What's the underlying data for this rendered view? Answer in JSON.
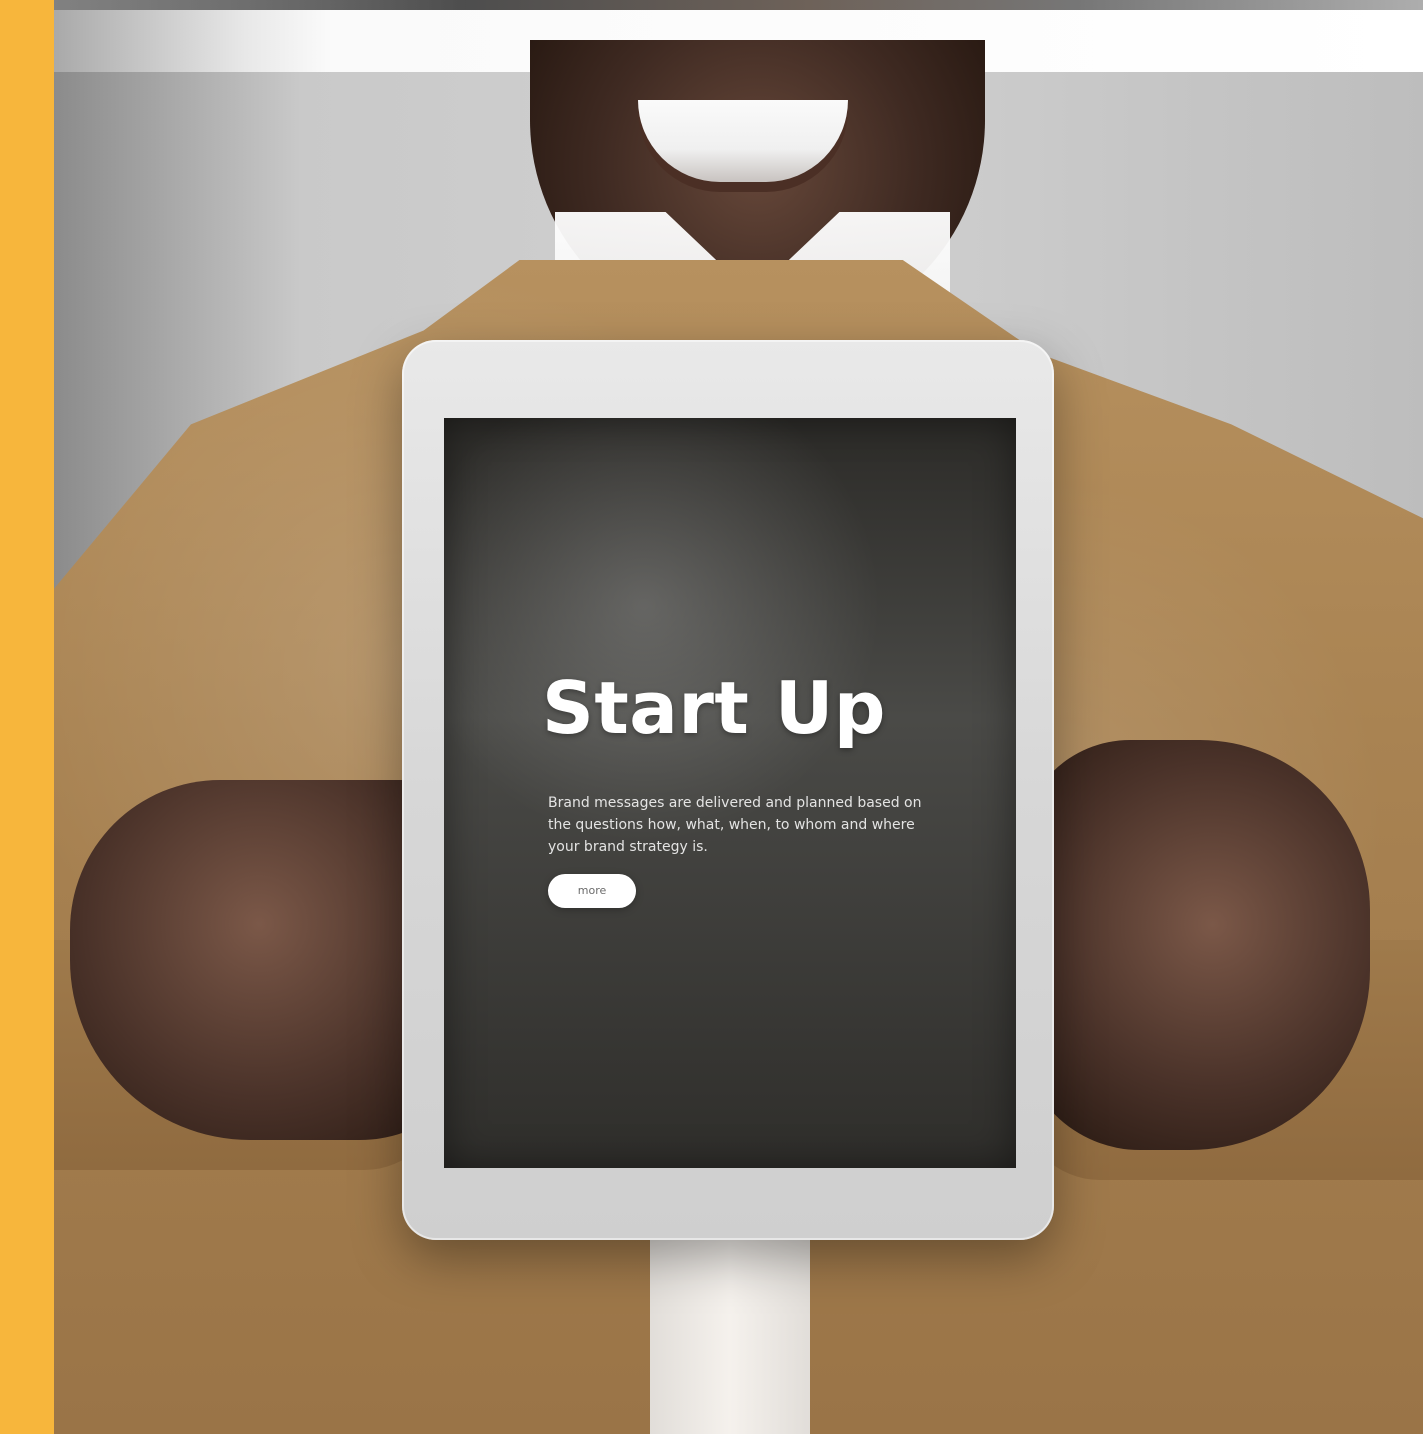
{
  "screen": {
    "title": "Start Up",
    "body": "Brand messages are delivered and planned based on the questions how, what, when, to whom and where your brand strategy is.",
    "button_label": "more"
  },
  "colors": {
    "accent_bar": "#f7b63c",
    "jacket": "#a98352",
    "tablet_frame": "#dddddd",
    "screen_bg": "#3d3c39",
    "title_text": "#ffffff"
  }
}
